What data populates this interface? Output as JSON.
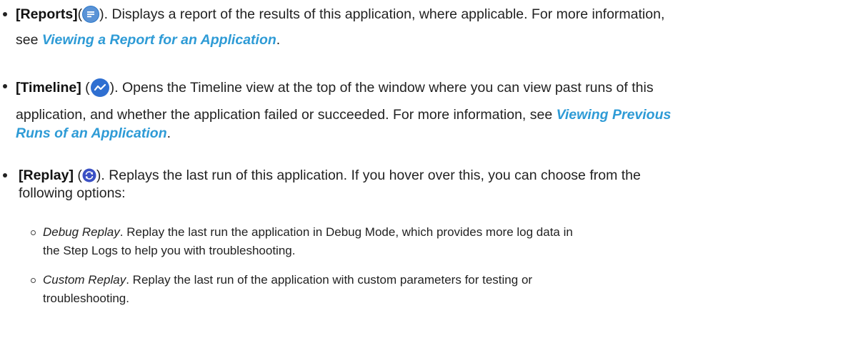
{
  "items": [
    {
      "term": "[Reports]",
      "icon": "reports-icon",
      "line1_after": ". Displays a report of the results of this application, where applicable. For more information,",
      "line2_before": "see ",
      "link": "Viewing a Report for an Application",
      "line2_after": "."
    },
    {
      "term": "[Timeline]",
      "icon": "timeline-icon",
      "line1_after": ". Opens the Timeline view at the top of the window where you can view past runs of this",
      "line2_before": "application, and whether the application failed or succeeded. For more information, see ",
      "link_part1": "Viewing Previous",
      "link_part2": "Runs of an Application",
      "line3_after": "."
    },
    {
      "term": "[Replay]",
      "icon": "replay-icon",
      "line1_after": ". Replays the last run of this application. If you hover over this, you can choose from the",
      "line2": "following options:"
    }
  ],
  "sub_items": [
    {
      "name": "Debug Replay",
      "line1": ". Replay the last run the application in Debug Mode, which provides more log data in",
      "line2": "the Step Logs to help you with troubleshooting."
    },
    {
      "name": "Custom Replay",
      "line1": ". Replay the last run of the application with custom parameters for testing or",
      "line2": "troubleshooting."
    }
  ],
  "colors": {
    "link": "#2e9bd6",
    "reports_icon_bg": "#2c78c9",
    "timeline_icon_bg": "#2f6fd1",
    "replay_icon_bg": "#3a50c4"
  }
}
